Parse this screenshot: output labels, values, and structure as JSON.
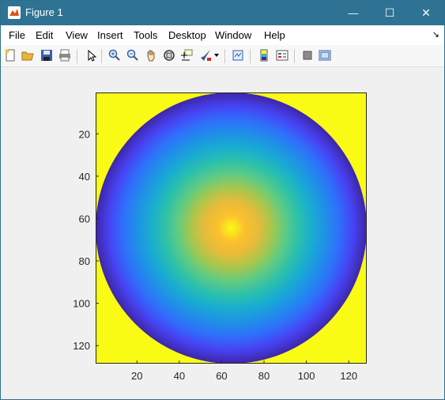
{
  "window": {
    "title": "Figure 1",
    "minimize_glyph": "—",
    "maximize_glyph": "☐",
    "close_glyph": "✕"
  },
  "menu": {
    "items": [
      "File",
      "Edit",
      "View",
      "Insert",
      "Tools",
      "Desktop",
      "Window",
      "Help"
    ],
    "dock_glyph": "↘"
  },
  "toolbar": {
    "icons": [
      "new-figure-icon",
      "open-file-icon",
      "save-icon",
      "print-icon",
      "edit-plot-icon",
      "zoom-in-icon",
      "zoom-out-icon",
      "pan-icon",
      "rotate-3d-icon",
      "data-cursor-icon",
      "brush-icon",
      "brush-dropdown-icon",
      "link-plot-icon",
      "insert-colorbar-icon",
      "insert-legend-icon",
      "hide-plot-tools-icon",
      "show-plot-tools-icon"
    ]
  },
  "colors": {
    "titlebar": "#2e7393",
    "background_yellow": "#f9fb15",
    "cmap": [
      "#3e26a8",
      "#4743f3",
      "#2f6ffb",
      "#1f90e7",
      "#19acd1",
      "#2cc0ab",
      "#5ecb84",
      "#a5c74e",
      "#e6bb3a",
      "#fdc02e",
      "#f9fb15"
    ]
  },
  "chart_data": {
    "type": "heatmap",
    "description_visible": "128x128 image with a disk of radius ~64 centered at (64,64); value increases toward center; outside disk is the maximum (yellow)",
    "x_ticks": [
      20,
      40,
      60,
      80,
      100,
      120
    ],
    "y_ticks": [
      20,
      40,
      60,
      80,
      100,
      120
    ],
    "xlim": [
      0.5,
      128.5
    ],
    "ylim": [
      0.5,
      128.5
    ],
    "y_direction": "reverse",
    "grid": false,
    "size": 128,
    "center": [
      64,
      64
    ],
    "radius": 64
  }
}
